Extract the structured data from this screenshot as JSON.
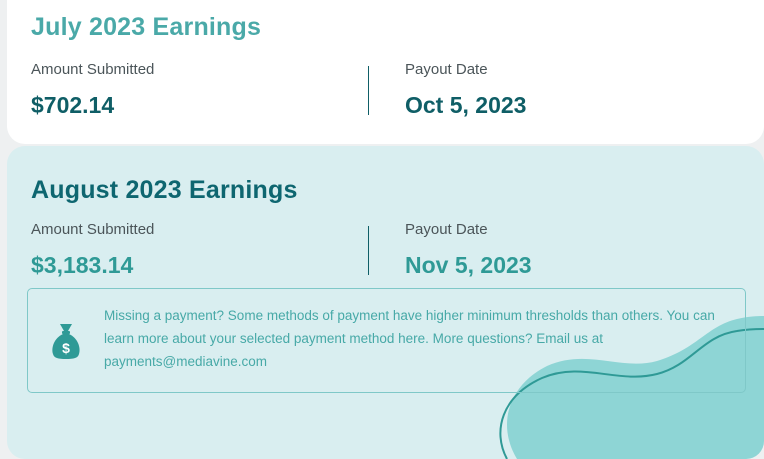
{
  "july": {
    "title": "July 2023 Earnings",
    "amount_label": "Amount Submitted",
    "amount_value": "$702.14",
    "payout_label": "Payout Date",
    "payout_value": "Oct 5, 2023"
  },
  "august": {
    "title": "August 2023 Earnings",
    "amount_label": "Amount Submitted",
    "amount_value": "$3,183.14",
    "payout_label": "Payout Date",
    "payout_value": "Nov 5, 2023"
  },
  "notice": {
    "icon": "money-bag-icon",
    "text": "Missing a payment? Some methods of payment have higher minimum thresholds than others. You can learn more about your selected payment method here. More questions? Email us at payments@mediavine.com"
  },
  "colors": {
    "teal_dark": "#0f5e66",
    "teal_light": "#4aa9a8",
    "card_bg_highlight": "#d9eef0",
    "blob": "#8ed5d5"
  }
}
